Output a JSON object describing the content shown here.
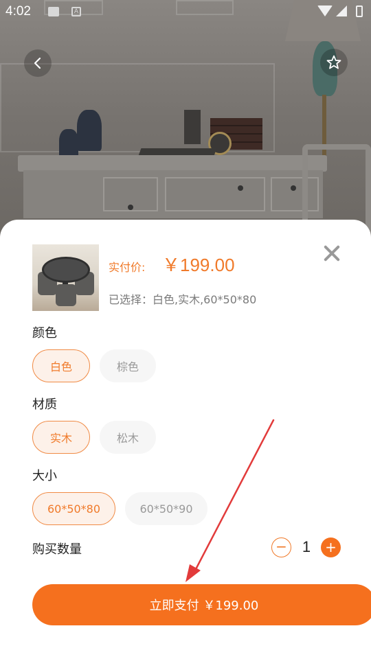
{
  "status_bar": {
    "time": "4:02",
    "a_badge": "A"
  },
  "product": {
    "price_label": "实付价:",
    "price_value": "￥199.00",
    "selected_text": "已选择：白色,实木,60*50*80"
  },
  "options": {
    "color": {
      "title": "颜色",
      "values": [
        "白色",
        "棕色"
      ],
      "selected": "白色"
    },
    "material": {
      "title": "材质",
      "values": [
        "实木",
        "松木"
      ],
      "selected": "实木"
    },
    "size": {
      "title": "大小",
      "values": [
        "60*50*80",
        "60*50*90"
      ],
      "selected": "60*50*80"
    }
  },
  "quantity": {
    "label": "购买数量",
    "value": "1",
    "minus": "−",
    "plus": "+"
  },
  "pay_button": {
    "label": "立即支付 ￥199.00"
  },
  "colors": {
    "accent": "#f5701e",
    "accent_text": "#f07a2a",
    "chip_selected_bg": "#fdf1e9",
    "annotation_arrow": "#e23b3b"
  }
}
